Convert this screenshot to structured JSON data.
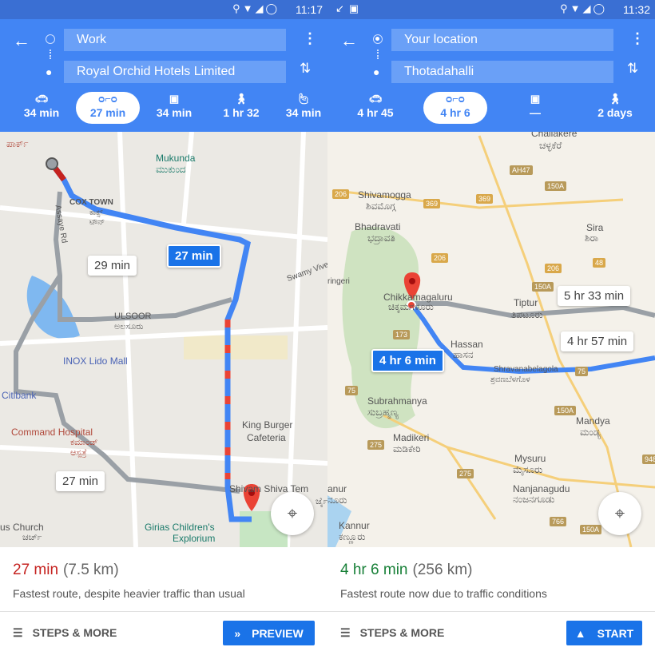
{
  "left": {
    "status": {
      "time": "11:17",
      "icons": [
        "location-icon",
        "wifi-icon",
        "signal-icon",
        "sync-icon"
      ]
    },
    "origin": "Work",
    "destination": "Royal Orchid Hotels Limited",
    "modes": [
      {
        "icon": "car-icon",
        "label": "34 min"
      },
      {
        "icon": "motorcycle-icon",
        "label": "27 min",
        "selected": true
      },
      {
        "icon": "transit-icon",
        "label": "34 min"
      },
      {
        "icon": "walk-icon",
        "label": "1 hr 32"
      },
      {
        "icon": "ride-hail-icon",
        "label": "34 min"
      }
    ],
    "map": {
      "labels": [
        "ಪಾರ್ಕ್",
        "Mukunda",
        "ಮುಕುಂದ",
        "COX TOWN",
        "ಕಾಕ್ಸ್",
        "ಟೌನ್",
        "Assaye Rd",
        "Swamy Vive",
        "ULSOOR",
        "ಅಲಸೂರು",
        "INOX Lido Mall",
        "Citibank",
        "Command Hospital",
        "ಕಮಾಂಡ್",
        "ಆಸ್ಪತ್ರೆ",
        "King Burger",
        "Cafeteria",
        "Shivam Shiva Tem",
        "ರ್ಜೈ",
        "us Church",
        "ಚರ್ಚ್",
        "Girias Children's",
        "Explorium"
      ],
      "bubbles": {
        "main": "27 min",
        "alt1": "29 min",
        "alt2": "27 min"
      }
    },
    "eta": {
      "time": "27 min",
      "distance": "(7.5 km)",
      "description": "Fastest route, despite heavier traffic than usual"
    },
    "steps_label": "STEPS & MORE",
    "action_label": "PREVIEW"
  },
  "right": {
    "status": {
      "time": "11:32",
      "icons": [
        "missed-call-icon",
        "image-icon",
        "location-icon",
        "wifi-icon",
        "signal-icon",
        "sync-icon"
      ]
    },
    "origin": "Your location",
    "destination": "Thotadahalli",
    "modes": [
      {
        "icon": "car-icon",
        "label": "4 hr 45"
      },
      {
        "icon": "motorcycle-icon",
        "label": "4 hr 6",
        "selected": true
      },
      {
        "icon": "transit-icon",
        "label": "—"
      },
      {
        "icon": "walk-icon",
        "label": "2 days"
      }
    ],
    "map": {
      "labels": [
        "Challakere",
        "ಚಳ್ಳಕೆರೆ",
        "Shivamogga",
        "ಶಿವಮೊಗ್ಗ",
        "Bhadravati",
        "ಭದ್ರಾವತಿ",
        "Sira",
        "ಶಿರಾ",
        "ringeri",
        "Chikkamagaluru",
        "ಚಿಕ್ಕಮಗಳೂರು",
        "Tiptur",
        "ತಿಪಟೂರು",
        "Hassan",
        "ಹಾಸನ",
        "Shravanabelagola",
        "ಶ್ರವಣಬೆಳಗೊಳ",
        "Subrahmanya",
        "ಸುಬ್ರಹ್ಮಣ್ಯ",
        "Mandya",
        "ಮಂಡ್ಯ",
        "Madikeri",
        "ಮಡಿಕೇರಿ",
        "Mysuru",
        "ಮೈಸೂರು",
        "Nanjanagudu",
        "ನಂಜನಗೂಡು",
        "anur",
        "ನೂರು",
        "Kannur",
        "ಕಣ್ಣೂರು"
      ],
      "shields": [
        "AH47",
        "206",
        "369",
        "150A",
        "369",
        "206",
        "48",
        "206",
        "150A",
        "173",
        "75",
        "75",
        "150A",
        "275",
        "275",
        "766",
        "150A",
        "948"
      ],
      "bubbles": {
        "main": "4 hr 6 min",
        "alt1": "5 hr 33 min",
        "alt2": "4 hr 57 min"
      }
    },
    "eta": {
      "time": "4 hr 6 min",
      "distance": "(256 km)",
      "description": "Fastest route now due to traffic conditions"
    },
    "steps_label": "STEPS & MORE",
    "action_label": "START"
  },
  "colors": {
    "header": "#4285f4",
    "status_bar": "#3a6fd3",
    "route": "#4285f4",
    "button": "#1a73e8",
    "eta_red": "#c5221f",
    "eta_green": "#188038"
  }
}
